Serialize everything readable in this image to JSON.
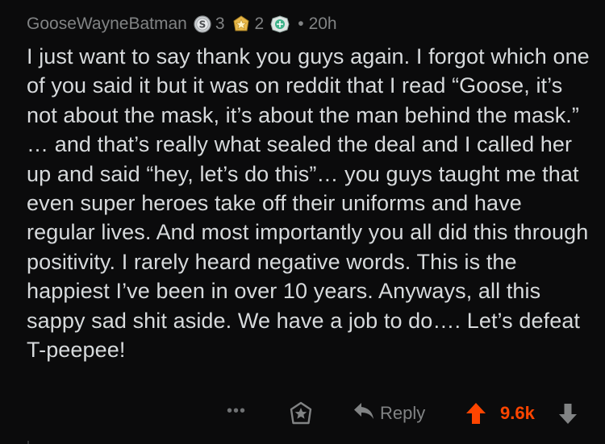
{
  "comment": {
    "username": "GooseWayneBatman",
    "awards": [
      {
        "icon": "silver-s-award-icon",
        "count": "3"
      },
      {
        "icon": "gold-star-award-icon",
        "count": "2"
      },
      {
        "icon": "green-platinum-award-icon",
        "count": ""
      }
    ],
    "separator": "•",
    "age": "20h",
    "body": "I just want to say thank you guys again. I forgot which one of you said it but it was on reddit that I read “Goose, it’s not about the mask, it’s about the man behind the mask.” … and that’s really what sealed the deal and I called her up and said “hey, let’s do this”… you guys taught me that even super heroes take off their uniforms and have regular lives. And most importantly you all did this through positivity. I rarely heard negative words. This is the happiest I’ve been in over 10 years. Anyways, all this sappy sad shit aside. We have a job to do…. Let’s defeat T-peepee!"
  },
  "actions": {
    "more_label": "•••",
    "reply_label": "Reply",
    "score": "9.6k",
    "upvote_color": "#ff4500"
  }
}
